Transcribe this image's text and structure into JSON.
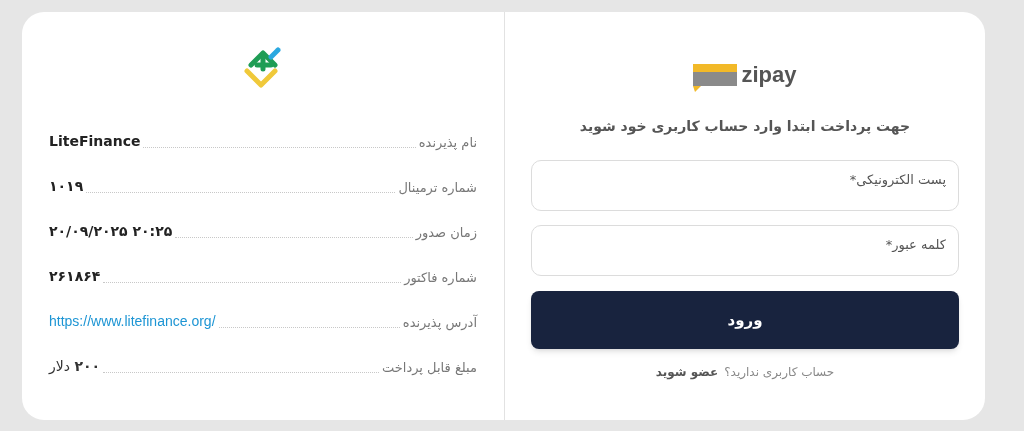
{
  "invoice": {
    "rows": [
      {
        "label": "نام پذیرنده",
        "value": "LiteFinance",
        "kind": "text"
      },
      {
        "label": "شماره ترمینال",
        "value": "۱۰۱۹",
        "kind": "text"
      },
      {
        "label": "زمان صدور",
        "value": "۲۰/۰۹/۲۰۲۵ ۲۰:۲۵",
        "kind": "text"
      },
      {
        "label": "شماره فاکتور",
        "value": "۲۶۱۸۶۴",
        "kind": "text"
      },
      {
        "label": "آدرس پذیرنده",
        "value": "https://www.litefinance.org/",
        "kind": "link"
      },
      {
        "label": "مبلغ قابل پرداخت",
        "value": "**۲۰۰** دلار",
        "kind": "amount"
      }
    ]
  },
  "login": {
    "logo_text": "zipay",
    "heading": "جهت پرداخت ابتدا وارد حساب کاربری خود شوید",
    "fields": [
      {
        "placeholder": "پست الکترونیکی*"
      },
      {
        "placeholder": "کلمه عبور*"
      }
    ],
    "submit": "ورود",
    "signup_prompt": "حساب کاربری ندارید؟",
    "signup_link": "عضو شوید"
  }
}
